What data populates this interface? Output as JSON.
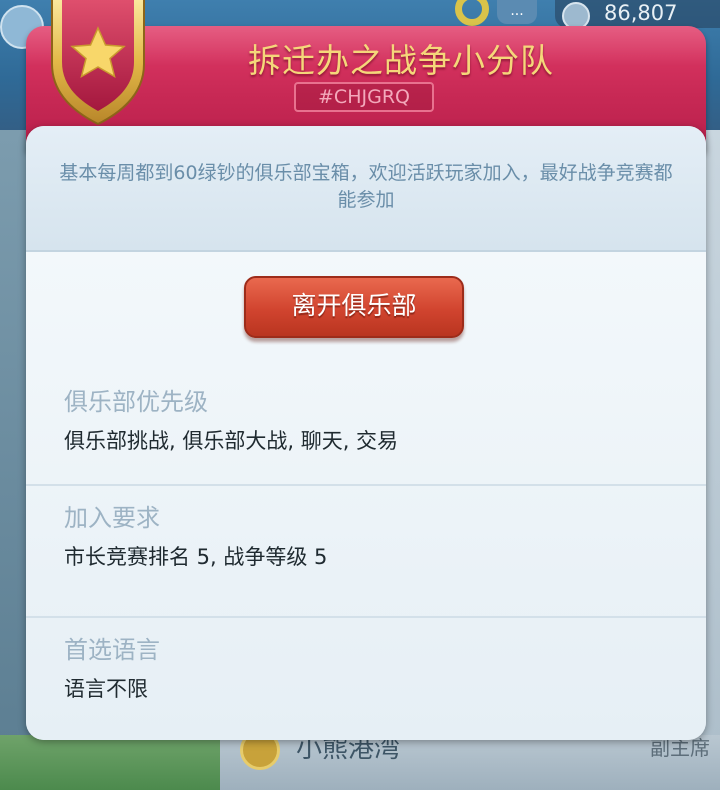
{
  "background": {
    "balance": "86,807",
    "more_label": "...",
    "peek_club_name": "小熊港湾",
    "peek_role": "副主席"
  },
  "club": {
    "name": "拆迁办之战争小分队",
    "tag": "#CHJGRQ",
    "description": "基本每周都到60绿钞的俱乐部宝箱，欢迎活跃玩家加入，最好战争竞赛都能参加",
    "leave_button": "离开俱乐部",
    "priority": {
      "label": "俱乐部优先级",
      "value": "俱乐部挑战, 俱乐部大战, 聊天, 交易"
    },
    "requirements": {
      "label": "加入要求",
      "value": "市长竞赛排名 5, 战争等级 5"
    },
    "language": {
      "label": "首选语言",
      "value": "语言不限"
    }
  },
  "colors": {
    "header": "#c82955",
    "title_gold": "#f5d77a",
    "leave_button": "#d1442f",
    "label_muted": "#9db3c4"
  },
  "icons": {
    "badge": "star-shield-icon"
  }
}
